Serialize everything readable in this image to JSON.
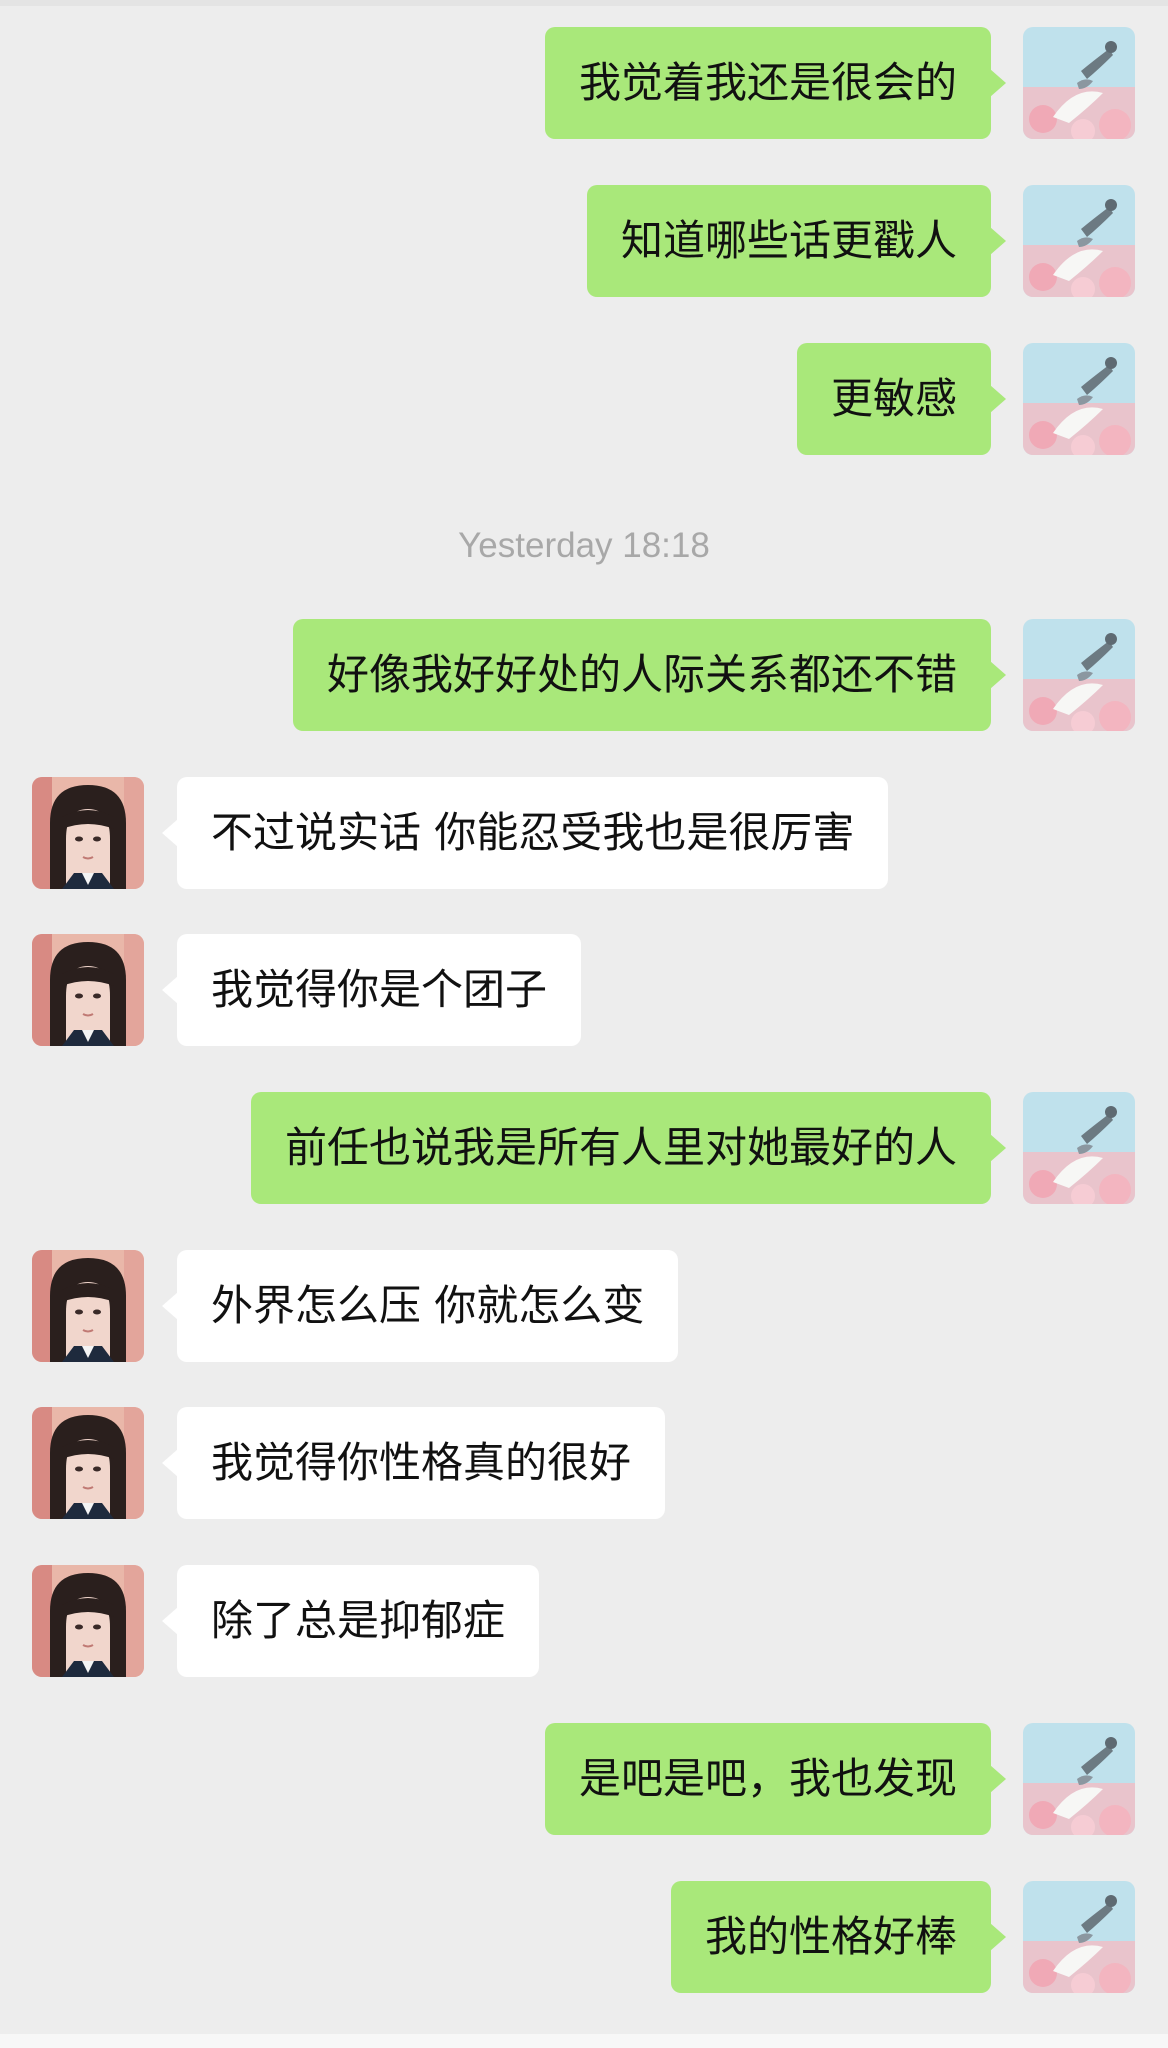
{
  "chat": {
    "timestamp": "Yesterday 18:18",
    "messages": [
      {
        "side": "self",
        "text": "我觉着我还是很会的"
      },
      {
        "side": "self",
        "text": "知道哪些话更戳人"
      },
      {
        "side": "self",
        "text": "更敏感"
      },
      {
        "side": "self",
        "text": "好像我好好处的人际关系都还不错"
      },
      {
        "side": "other",
        "text": "不过说实话 你能忍受我也是很厉害"
      },
      {
        "side": "other",
        "text": "我觉得你是个团子"
      },
      {
        "side": "self",
        "text": "前任也说我是所有人里对她最好的人"
      },
      {
        "side": "other",
        "text": "外界怎么压 你就怎么变"
      },
      {
        "side": "other",
        "text": "我觉得你性格真的很好"
      },
      {
        "side": "other",
        "text": "除了总是抑郁症"
      },
      {
        "side": "self",
        "text": "是吧是吧，我也发现"
      },
      {
        "side": "self",
        "text": "我的性格好棒"
      }
    ]
  },
  "colors": {
    "background": "#ededed",
    "self_bubble": "#a9e87a",
    "other_bubble": "#ffffff",
    "timestamp_text": "#a8a8a8"
  },
  "icons": {
    "self_avatar": "self-avatar-illustration",
    "other_avatar": "contact-avatar-photo"
  }
}
